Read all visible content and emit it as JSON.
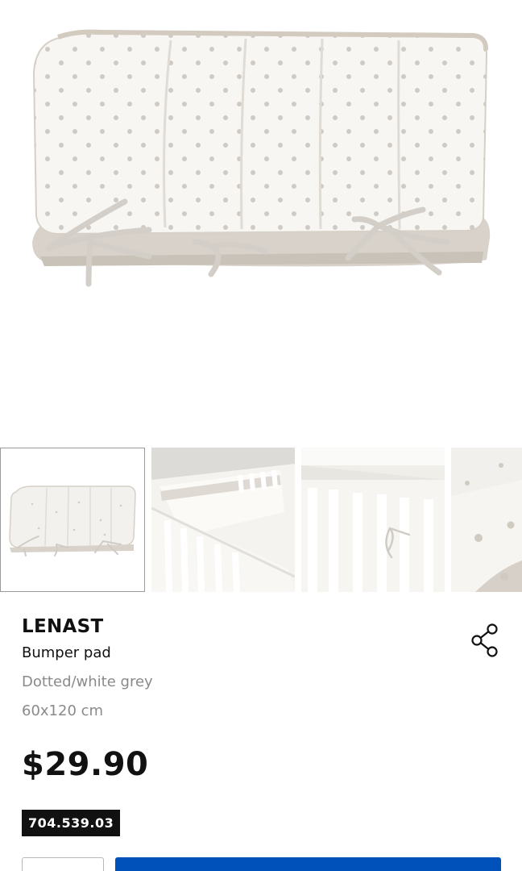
{
  "product": {
    "name": "LENAST",
    "type": "Bumper pad",
    "variant": "Dotted/white grey",
    "size": "60x120 cm",
    "price": "$29.90",
    "article_number": "704.539.03"
  },
  "thumbnails": [
    {
      "label": "bumper-pad-product",
      "selected": true
    },
    {
      "label": "bumper-pad-in-crib",
      "selected": false
    },
    {
      "label": "bumper-pad-crib-closeup",
      "selected": false
    },
    {
      "label": "dotted-fabric-closeup",
      "selected": false
    }
  ],
  "icons": {
    "share": "share-icon"
  },
  "colors": {
    "accent": "#0051ba",
    "text": "#111111",
    "muted": "#8a8a8a",
    "article_bg": "#111111"
  }
}
